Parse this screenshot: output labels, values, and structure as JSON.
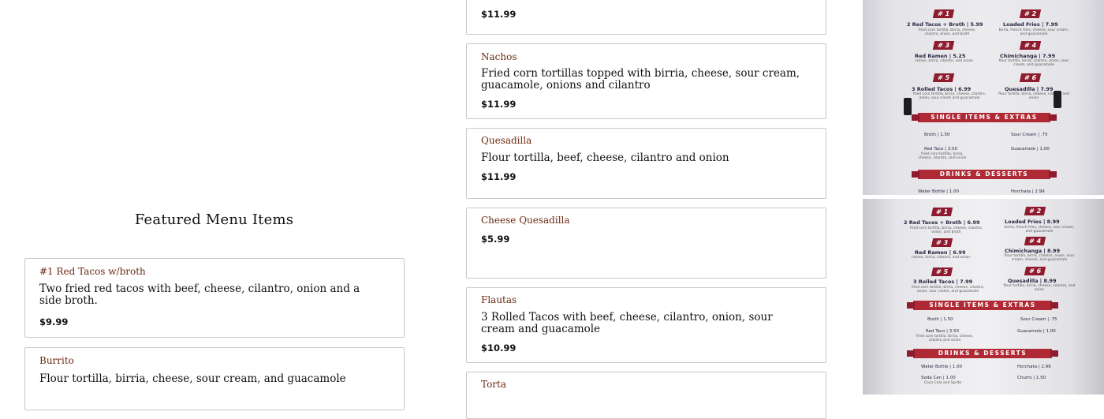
{
  "featured": {
    "title": "Featured Menu Items",
    "left_items": [
      {
        "name": "#1 Red Tacos w/broth",
        "desc": "Two fried red tacos with beef, cheese, cilantro, onion and a side broth.",
        "price": "$9.99"
      },
      {
        "name": "Burrito",
        "desc": "Flour tortilla, birria, cheese, sour cream, and guacamole",
        "price": ""
      }
    ],
    "right_items": [
      {
        "name": "",
        "desc": "",
        "price": "$11.99"
      },
      {
        "name": "Nachos",
        "desc": "Fried corn tortillas topped with birria, cheese, sour cream, guacamole, onions and cilantro",
        "price": "$11.99"
      },
      {
        "name": "Quesadilla",
        "desc": "Flour tortilla, beef, cheese, cilantro and onion",
        "price": "$11.99"
      },
      {
        "name": "Cheese Quesadilla",
        "desc": "",
        "price": "$5.99"
      },
      {
        "name": "Flautas",
        "desc": "3 Rolled Tacos with beef, cheese, cilantro, onion, sour cream and guacamole",
        "price": "$10.99"
      },
      {
        "name": "Torta",
        "desc": "",
        "price": ""
      }
    ]
  },
  "photo_top": {
    "badges": [
      "# 1",
      "# 2",
      "# 3",
      "# 4",
      "# 5",
      "# 6"
    ],
    "items": [
      {
        "name": "2 Red Tacos + Broth  |  5.99",
        "sub": "fried corn tortilla, birria, cheese, cilantro, onion, and broth"
      },
      {
        "name": "Loaded Fries  |  7.99",
        "sub": "birria, french fries, cheese, sour cream, and guacamole"
      },
      {
        "name": "Red Ramen  |  5.25",
        "sub": "ramen, birria, cilantro, and onion"
      },
      {
        "name": "Chimichanga  |  7.99",
        "sub": "flour tortilla, birria, cilantro, onion, sour cream, and guacamole"
      },
      {
        "name": "3 Rolled Tacos  |  6.99",
        "sub": "fried corn tortilla, birria, cheese, cilantro, onion, sour cream and guacamole"
      },
      {
        "name": "Quesadilla  |  7.99",
        "sub": "flour tortilla, birria, cheese, cilantro and onion"
      }
    ],
    "banner1": "SINGLE ITEMS & EXTRAS",
    "extras": [
      {
        "name": "Broth  |  1.50"
      },
      {
        "name": "Sour Cream  |  .75"
      },
      {
        "name": "Red Taco  |  3.00",
        "sub": "fried corn tortilla, birria, cheese, cilantro, and onion"
      },
      {
        "name": "Guacamole  |  1.00"
      }
    ],
    "banner2": "DRINKS & DESSERTS",
    "drinks": [
      {
        "name": "Water Bottle  |  1.00"
      },
      {
        "name": "Horchata  |  2.99"
      }
    ]
  },
  "photo_bottom": {
    "badges": [
      "# 1",
      "# 2",
      "# 3",
      "# 4",
      "# 5",
      "# 6"
    ],
    "items": [
      {
        "name": "2 Red Tacos + Broth  |  6.99",
        "sub": "fried corn tortilla, birria, cheese, cilantro, onion, and broth"
      },
      {
        "name": "Loaded Fries  |  8.99",
        "sub": "birria, french fries, cheese, sour cream, and guacamole"
      },
      {
        "name": "Red Ramen  |  6.99",
        "sub": "ramen, birria, cilantro, and onion"
      },
      {
        "name": "Chimichanga  |  8.99",
        "sub": "flour tortilla, birria, cilantro, onion, sour cream, cheese, and guacamole"
      },
      {
        "name": "3 Rolled Tacos  |  7.99",
        "sub": "fried corn tortilla, birria, cheese, cilantro, onion, sour cream, and guacamole"
      },
      {
        "name": "Quesadilla  |  8.99",
        "sub": "flour tortilla, birria, cheese, cilantro, and onion"
      }
    ],
    "banner1": "SINGLE ITEMS & EXTRAS",
    "extras": [
      {
        "name": "Broth  |  1.50"
      },
      {
        "name": "Sour Cream  |  .75"
      },
      {
        "name": "Red Taco  |  3.50",
        "sub": "fried corn tortilla, birria, cheese, cilantro and onion"
      },
      {
        "name": "Guacamole  |  1.00"
      }
    ],
    "banner2": "DRINKS & DESSERTS",
    "drinks": [
      {
        "name": "Water Bottle  |  1.00"
      },
      {
        "name": "Horchata  |  2.99"
      },
      {
        "name": "Soda Can  |  1.00",
        "sub": "Coca Cola and Sprite"
      },
      {
        "name": "Churro  |  1.50"
      }
    ]
  },
  "colors": {
    "name_accent": "#6b2a10",
    "badge_red": "#8e1c2e",
    "banner_red": "#b02a36"
  }
}
